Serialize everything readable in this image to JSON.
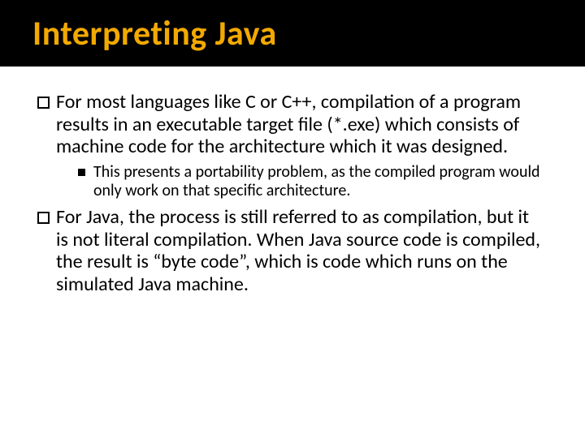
{
  "slide": {
    "title": "Interpreting Java",
    "bullets": [
      {
        "level": 1,
        "text": "For most languages like C or C++, compilation of a program results in an executable target file (*.exe) which consists of machine code for the architecture which it was designed."
      },
      {
        "level": 2,
        "text": "This presents a portability problem, as the compiled program would only work on that specific architecture."
      },
      {
        "level": 1,
        "text": "For Java, the process is still referred to as compilation, but it is not literal compilation. When Java source code is compiled, the result is “byte code”, which is code which runs on the simulated Java machine."
      }
    ]
  }
}
